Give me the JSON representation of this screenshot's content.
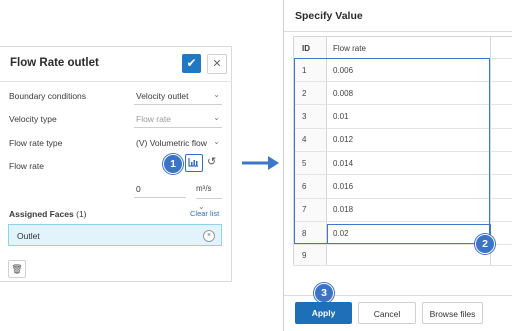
{
  "left_panel": {
    "title": "Flow Rate outlet",
    "rows": [
      {
        "label": "Boundary conditions",
        "value": "Velocity outlet"
      },
      {
        "label": "Velocity type",
        "value": "Flow rate"
      },
      {
        "label": "Flow rate type",
        "value": "(V) Volumetric flow"
      },
      {
        "label": "Flow rate",
        "value": ""
      }
    ],
    "flow_rate_value": "0",
    "flow_rate_unit": "m³/s",
    "assigned_faces_label": "Assigned Faces",
    "assigned_faces_count": "(1)",
    "clear_list": "Clear list",
    "assigned_items": [
      "Outlet"
    ]
  },
  "callouts": {
    "one": "1",
    "two": "2",
    "three": "3"
  },
  "dialog": {
    "title": "Specify Value",
    "columns": [
      "ID",
      "Flow rate"
    ],
    "rows": [
      {
        "id": "1",
        "value": "0.006"
      },
      {
        "id": "2",
        "value": "0.008"
      },
      {
        "id": "3",
        "value": "0.01"
      },
      {
        "id": "4",
        "value": "0.012"
      },
      {
        "id": "5",
        "value": "0.014"
      },
      {
        "id": "6",
        "value": "0.016"
      },
      {
        "id": "7",
        "value": "0.018"
      },
      {
        "id": "8",
        "value": "0.02"
      },
      {
        "id": "9",
        "value": ""
      }
    ],
    "buttons": {
      "apply": "Apply",
      "cancel": "Cancel",
      "browse": "Browse files"
    }
  },
  "colors": {
    "accent": "#1d6fb8",
    "callout": "#3b73c7",
    "chip_bg": "#e1f3fb"
  },
  "icons": [
    "check-icon",
    "close-icon",
    "table-icon",
    "reset-icon",
    "chevron-down-icon",
    "trash-icon",
    "arrow-right-icon"
  ]
}
